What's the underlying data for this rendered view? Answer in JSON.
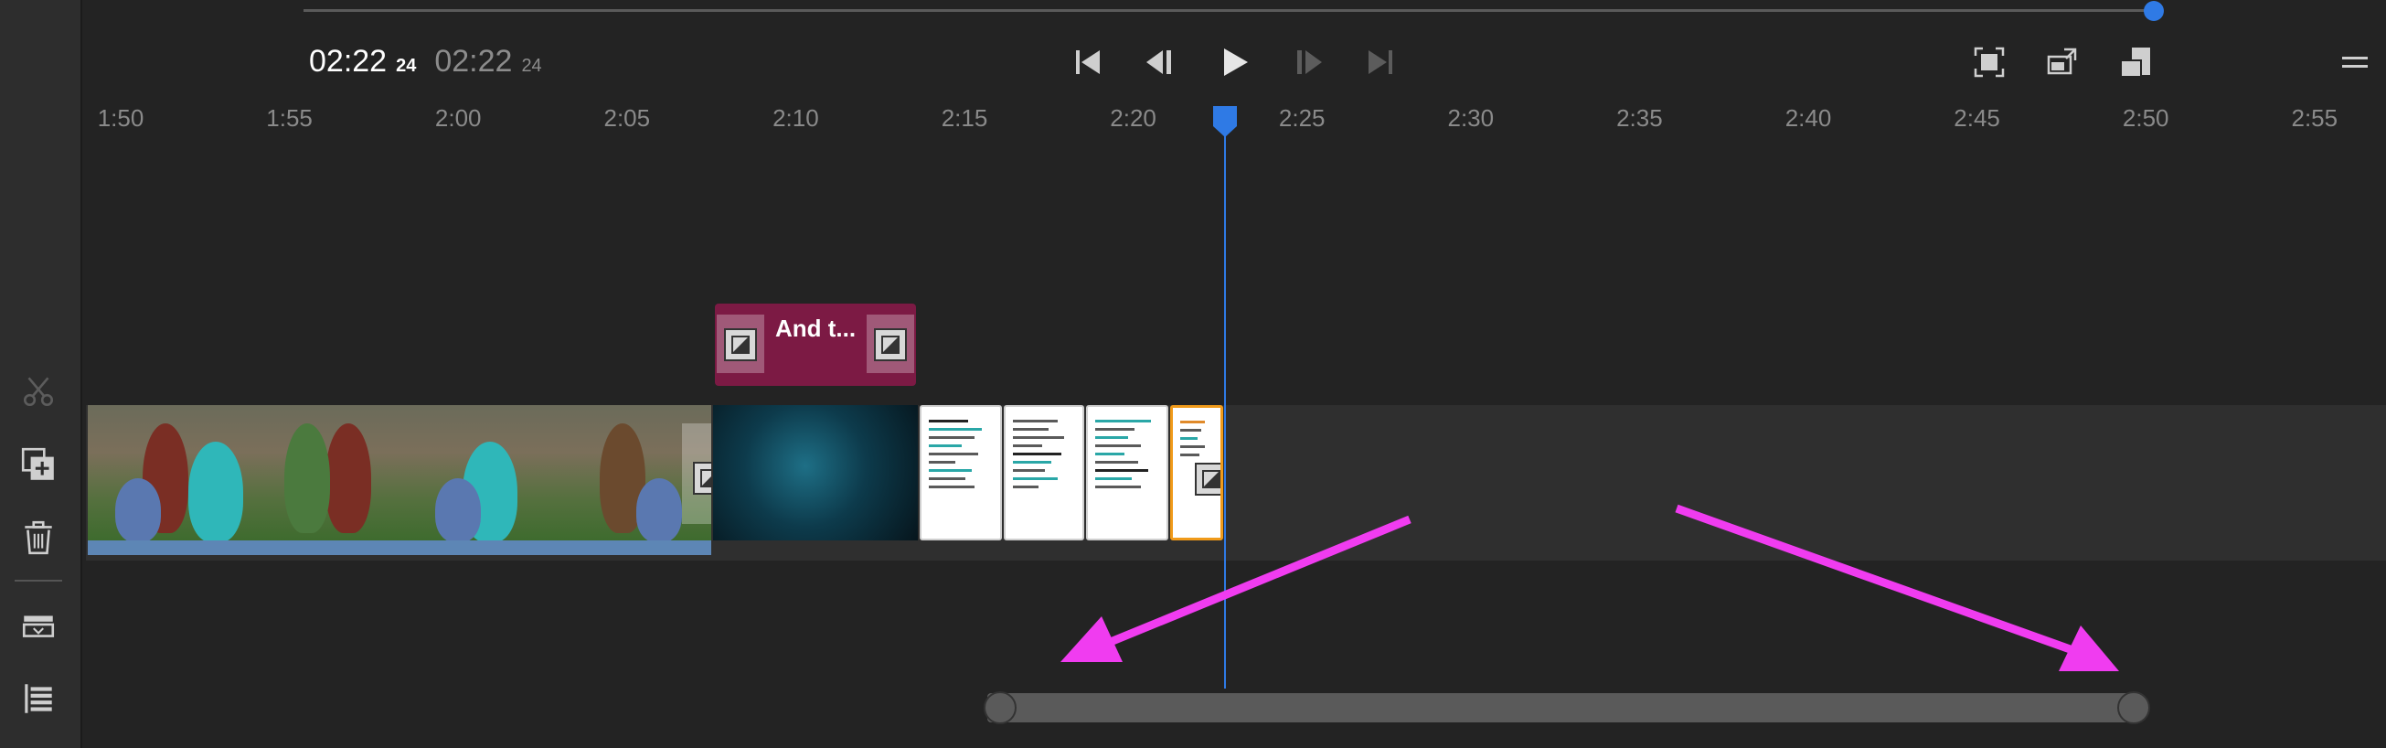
{
  "toolbar": {
    "tools": [
      {
        "name": "split-clip",
        "icon": "scissors-icon",
        "enabled": false
      },
      {
        "name": "add-media",
        "icon": "add-media-icon",
        "enabled": true
      },
      {
        "name": "delete-clip",
        "icon": "trash-icon",
        "enabled": true
      },
      {
        "name": "track-view",
        "icon": "track-view-icon",
        "enabled": true
      },
      {
        "name": "track-list",
        "icon": "track-list-icon",
        "enabled": true
      }
    ]
  },
  "scrubber": {
    "progress": 0.995
  },
  "timecode": {
    "current": "02:22",
    "current_frame": "24",
    "duration": "02:22",
    "duration_frame": "24"
  },
  "transport": {
    "buttons": [
      "skip-to-start-icon",
      "step-back-icon",
      "play-icon",
      "step-forward-icon",
      "skip-to-end-icon"
    ]
  },
  "right_controls": [
    "fit-to-screen-icon",
    "loop-icon",
    "picture-in-picture-icon",
    "menu-icon"
  ],
  "ruler": {
    "ticks": [
      "1:50",
      "1:55",
      "2:00",
      "2:05",
      "2:10",
      "2:15",
      "2:20",
      "2:25",
      "2:30",
      "2:35",
      "2:40",
      "2:45",
      "2:50",
      "2:55"
    ]
  },
  "title_clip": {
    "label": "And t..."
  },
  "colors": {
    "accent": "#2f7ae5",
    "title_clip": "#7c1a44",
    "selected_clip_border": "#f09a1a",
    "annotation_arrows": "#f03cf0"
  }
}
